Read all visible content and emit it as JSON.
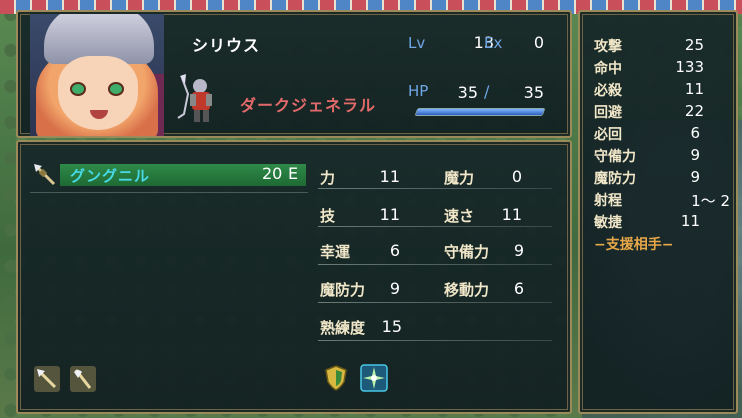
{
  "unit": {
    "name": "シリウス",
    "class": "ダークジェネラル",
    "lv_label": "Lv",
    "lv": "13",
    "ex_label": "Ex",
    "ex": "0",
    "hp_label": "HP",
    "hp_current": "35",
    "hp_sep": "/",
    "hp_max": "35",
    "hp_fraction": 1.0
  },
  "weapon": {
    "icon": "spear-icon",
    "name": "グングニル",
    "uses": "20",
    "equipped": "E"
  },
  "items": [
    {
      "icon": "spear-icon"
    },
    {
      "icon": "axe-icon"
    }
  ],
  "stats": [
    {
      "label": "力",
      "value": "11"
    },
    {
      "label": "魔力",
      "value": "0"
    },
    {
      "label": "技",
      "value": "11"
    },
    {
      "label": "速さ",
      "value": "11"
    },
    {
      "label": "幸運",
      "value": "6"
    },
    {
      "label": "守備力",
      "value": "9"
    },
    {
      "label": "魔防力",
      "value": "9"
    },
    {
      "label": "移動力",
      "value": "6"
    },
    {
      "label": "熟練度",
      "value": "15"
    }
  ],
  "skills": [
    {
      "icon": "shield-icon"
    },
    {
      "icon": "sparkle-icon"
    }
  ],
  "combat": [
    {
      "label": "攻撃",
      "value": "25"
    },
    {
      "label": "命中",
      "value": "133"
    },
    {
      "label": "必殺",
      "value": "11"
    },
    {
      "label": "回避",
      "value": "22"
    },
    {
      "label": "必回",
      "value": "6"
    },
    {
      "label": "守備力",
      "value": "9"
    },
    {
      "label": "魔防力",
      "value": "9"
    },
    {
      "label": "射程",
      "value": "1〜 2"
    },
    {
      "label": "敏捷",
      "value": "11"
    }
  ],
  "support_label": "−支援相手−",
  "colors": {
    "frame": "#9c8a5a",
    "label_blue": "#6fa6e6",
    "class_red": "#e36a6a",
    "weapon_cyan": "#48d8e6",
    "weapon_highlight": "#2f8a48",
    "support_orange": "#e8a848"
  }
}
